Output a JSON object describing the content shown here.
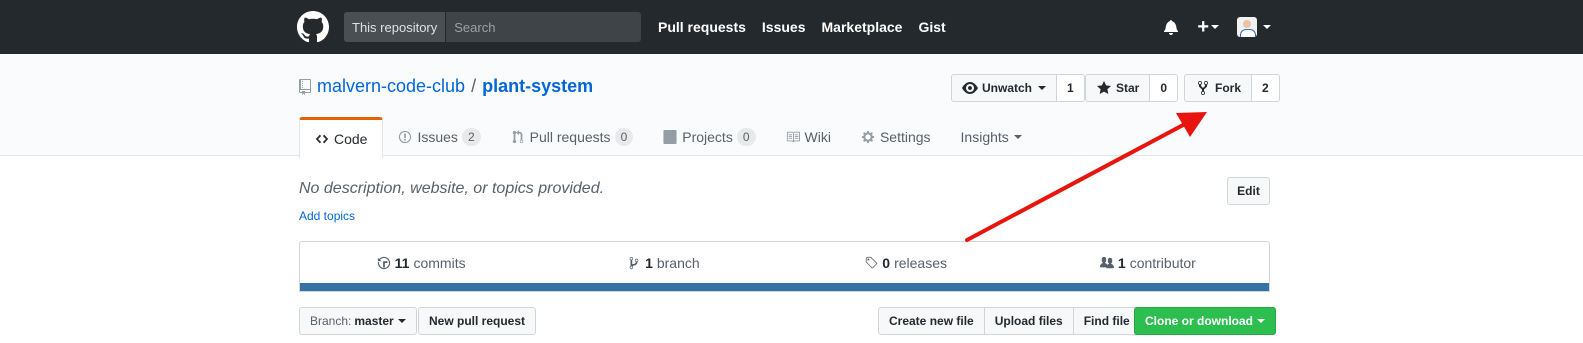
{
  "header": {
    "search_scope": "This repository",
    "search_placeholder": "Search",
    "nav": [
      "Pull requests",
      "Issues",
      "Marketplace",
      "Gist"
    ],
    "plus_label": "+"
  },
  "repo": {
    "owner": "malvern-code-club",
    "separator": "/",
    "name": "plant-system"
  },
  "actions": {
    "watch_label": "Unwatch",
    "watch_count": "1",
    "star_label": "Star",
    "star_count": "0",
    "fork_label": "Fork",
    "fork_count": "2"
  },
  "tabs": {
    "code": "Code",
    "issues": "Issues",
    "issues_count": "2",
    "pulls": "Pull requests",
    "pulls_count": "0",
    "projects": "Projects",
    "projects_count": "0",
    "wiki": "Wiki",
    "settings": "Settings",
    "insights": "Insights"
  },
  "description": {
    "text": "No description, website, or topics provided.",
    "add_topics": "Add topics",
    "edit_label": "Edit"
  },
  "summary": {
    "commits_num": "11",
    "commits_label": "commits",
    "branches_num": "1",
    "branches_label": "branch",
    "releases_num": "0",
    "releases_label": "releases",
    "contributors_num": "1",
    "contributors_label": "contributor",
    "language_color": "#3572a5"
  },
  "toolbar": {
    "branch_label": "Branch:",
    "branch_value": "master",
    "new_pr": "New pull request",
    "create_file": "Create new file",
    "upload_files": "Upload files",
    "find_file": "Find file",
    "clone": "Clone or download"
  },
  "colors": {
    "header_bg": "#24292e",
    "link": "#0366d6",
    "selected_tab_accent": "#e36209",
    "clone_green": "#2cbe4e",
    "annotation_arrow": "#e8150f"
  }
}
